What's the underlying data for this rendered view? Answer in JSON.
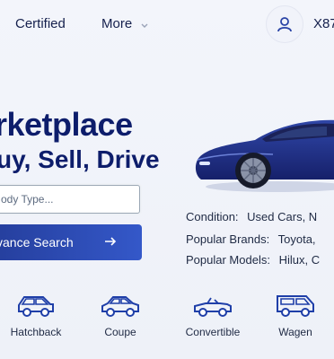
{
  "nav": {
    "items": [
      "Certified",
      "More"
    ],
    "user_name": "X87"
  },
  "hero": {
    "title": "rketplace",
    "subtitle": "uy, Sell, Drive"
  },
  "search": {
    "body_type_placeholder": "ody Type...",
    "advanced_label": "vance Search"
  },
  "info": {
    "rows": [
      {
        "label": "Condition:",
        "value": "Used Cars, N"
      },
      {
        "label": "Popular Brands:",
        "value": "Toyota,"
      },
      {
        "label": "Popular Models:",
        "value": "Hilux, C"
      }
    ]
  },
  "categories": [
    {
      "label": "Hatchback",
      "icon": "hatchback-icon"
    },
    {
      "label": "Coupe",
      "icon": "coupe-icon"
    },
    {
      "label": "Convertible",
      "icon": "convertible-icon"
    },
    {
      "label": "Wagen",
      "icon": "wagon-icon"
    }
  ],
  "colors": {
    "primary": "#0d1d6b",
    "button": "#2c4bb5",
    "icon_blue": "#1f3fa8"
  }
}
